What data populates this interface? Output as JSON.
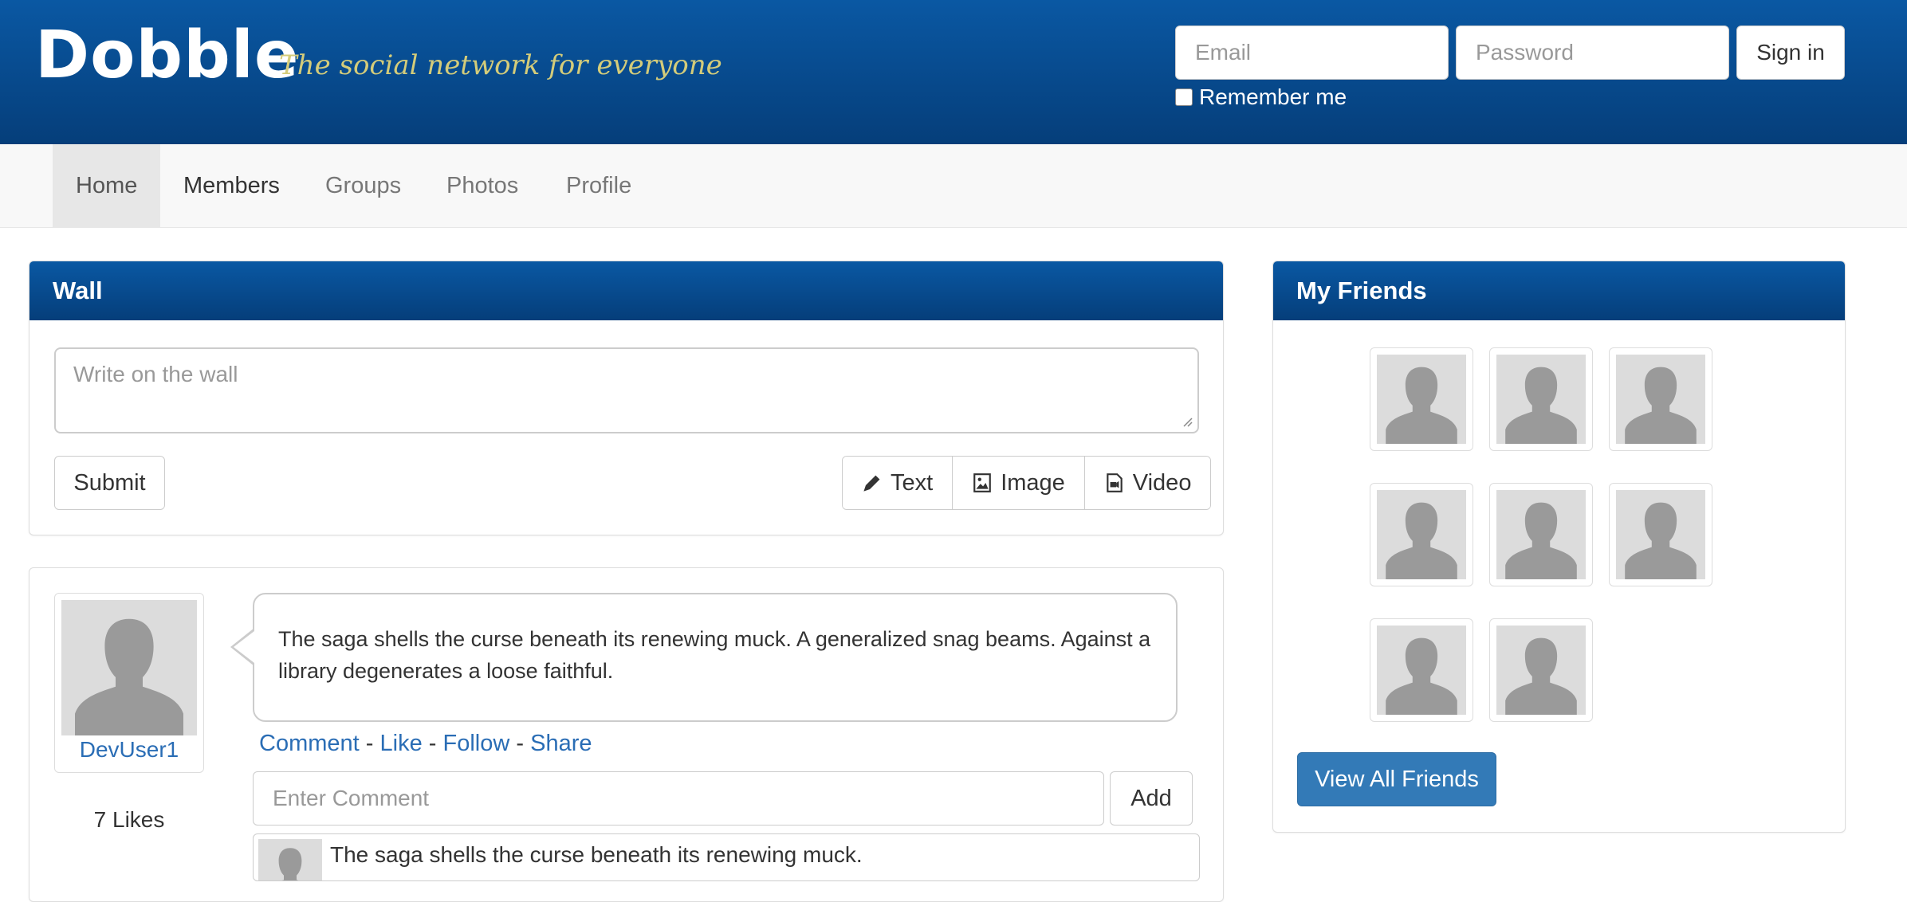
{
  "header": {
    "logo": "Dobble",
    "tagline": "The social network for everyone",
    "email_placeholder": "Email",
    "password_placeholder": "Password",
    "signin_label": "Sign in",
    "remember_label": "Remember me"
  },
  "nav": {
    "items": [
      {
        "label": "Home"
      },
      {
        "label": "Members"
      },
      {
        "label": "Groups"
      },
      {
        "label": "Photos"
      },
      {
        "label": "Profile"
      }
    ]
  },
  "wall": {
    "title": "Wall",
    "placeholder": "Write on the wall",
    "submit_label": "Submit",
    "type_buttons": [
      {
        "label": "Text",
        "icon": "pencil-icon"
      },
      {
        "label": "Image",
        "icon": "image-icon"
      },
      {
        "label": "Video",
        "icon": "video-file-icon"
      }
    ]
  },
  "post": {
    "author": "DevUser1",
    "likes": "7 Likes",
    "text": "The saga shells the curse beneath its renewing muck. A generalized snag beams. Against a library degenerates a loose faithful.",
    "actions": [
      "Comment",
      "Like",
      "Follow",
      "Share"
    ],
    "separator": "-",
    "comment_placeholder": "Enter Comment",
    "add_label": "Add",
    "comments": [
      {
        "text": "The saga shells the curse beneath its renewing muck."
      }
    ]
  },
  "friends": {
    "title": "My Friends",
    "count_shown": 8,
    "view_all_label": "View All Friends"
  },
  "colors": {
    "brand_blue": "#0a58a3",
    "link_blue": "#2a6db5",
    "primary_button": "#337ab7",
    "tagline_gold": "#d4cc7a"
  }
}
